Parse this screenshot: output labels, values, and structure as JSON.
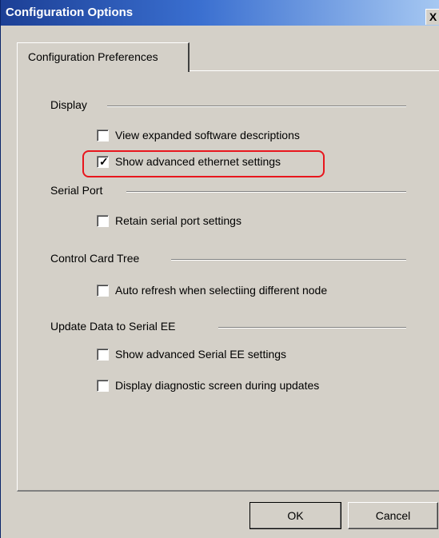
{
  "window": {
    "title": "Configuration Options",
    "close_label": "X"
  },
  "tabs": [
    {
      "label": "Configuration Preferences",
      "selected": true
    }
  ],
  "groups": [
    {
      "label": "Display",
      "options": [
        {
          "label": "View expanded software descriptions",
          "checked": false
        },
        {
          "label": "Show advanced ethernet settings",
          "checked": true,
          "highlighted": true
        }
      ]
    },
    {
      "label": "Serial Port",
      "options": [
        {
          "label": "Retain serial port settings",
          "checked": false
        }
      ]
    },
    {
      "label": "Control Card Tree",
      "options": [
        {
          "label": "Auto refresh when selectiing different node",
          "checked": false
        }
      ]
    },
    {
      "label": "Update Data to Serial EE",
      "options": [
        {
          "label": "Show advanced Serial EE settings",
          "checked": false
        },
        {
          "label": "Display diagnostic screen during updates",
          "checked": false
        }
      ]
    }
  ],
  "checkmark": "✓",
  "buttons": {
    "ok": "OK",
    "cancel": "Cancel"
  },
  "colors": {
    "highlight": "#e8161d",
    "titlebar_start": "#1c3f95",
    "titlebar_end": "#a6c8f2",
    "face": "#d4d0c8"
  }
}
